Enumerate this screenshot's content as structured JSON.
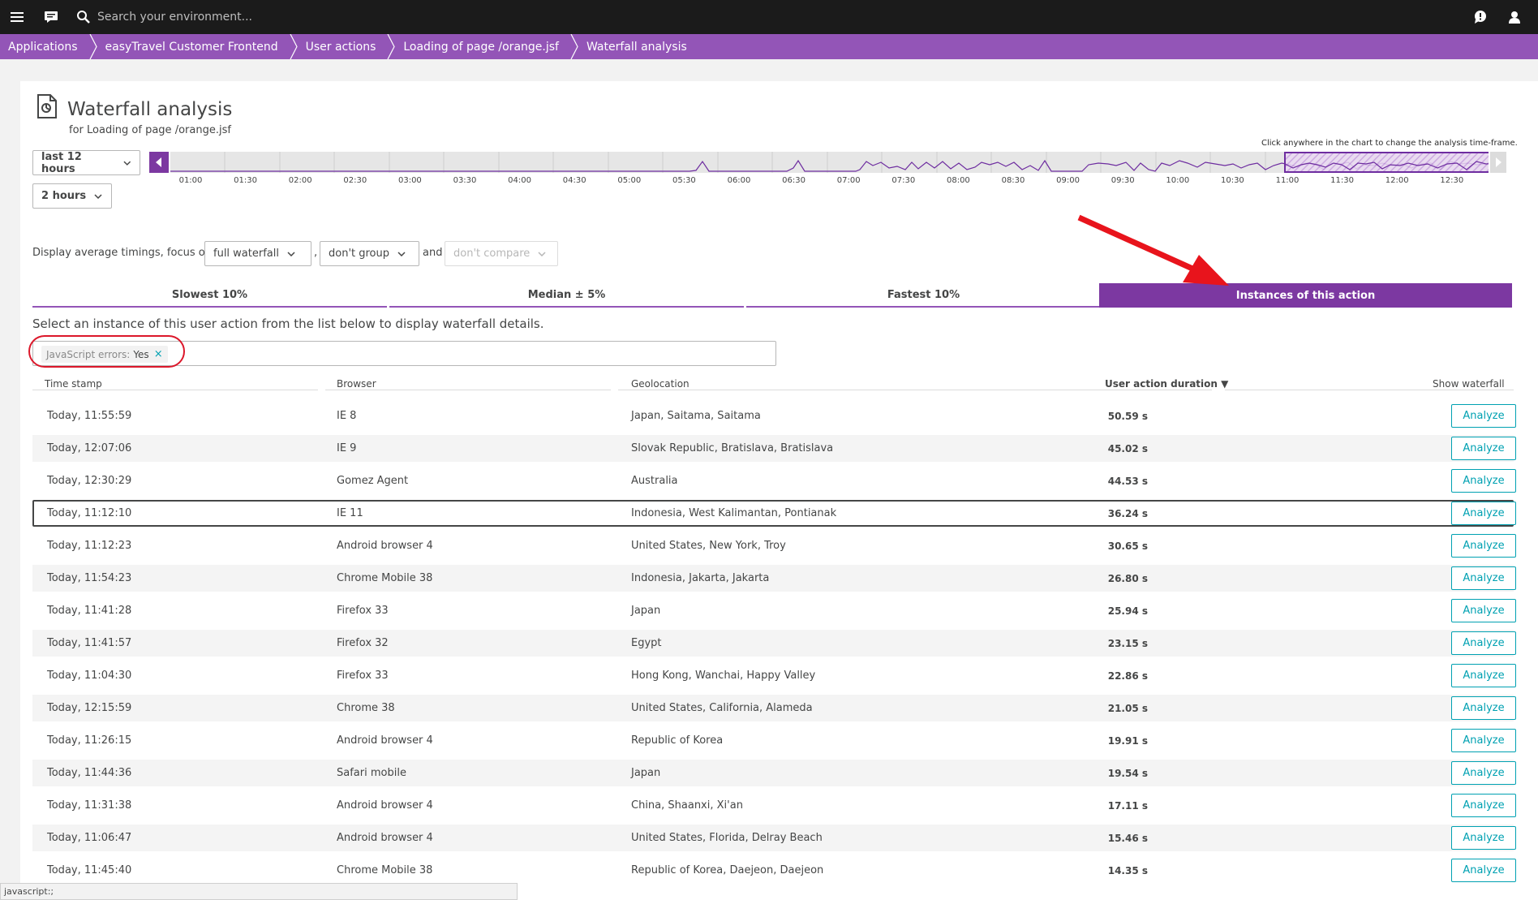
{
  "topbar": {
    "search_placeholder": "Search your environment...",
    "icons": [
      "menu-icon",
      "chat-icon",
      "search-icon",
      "help-bubble-icon",
      "user-icon"
    ]
  },
  "breadcrumb": [
    "Applications",
    "easyTravel Customer Frontend",
    "User actions",
    "Loading of page /orange.jsf",
    "Waterfall analysis"
  ],
  "page": {
    "title": "Waterfall analysis",
    "subtitle": "for Loading of page /orange.jsf"
  },
  "timeframe": {
    "range": "last 12 hours",
    "resolution": "2 hours",
    "hint": "Click anywhere in the chart to change the analysis time-frame.",
    "labels": [
      "01:00",
      "01:30",
      "02:00",
      "02:30",
      "03:00",
      "03:30",
      "04:00",
      "04:30",
      "05:00",
      "05:30",
      "06:00",
      "06:30",
      "07:00",
      "07:30",
      "08:00",
      "08:30",
      "09:00",
      "09:30",
      "10:00",
      "10:30",
      "11:00",
      "11:30",
      "12:00",
      "12:30"
    ]
  },
  "display": {
    "prefix": "Display average timings, focus on",
    "focus": "full waterfall",
    "comma": ",",
    "group": "don't group",
    "and": "and",
    "compare": "don't compare"
  },
  "tabs": [
    {
      "label": "Slowest 10%",
      "active": false
    },
    {
      "label": "Median ± 5%",
      "active": false
    },
    {
      "label": "Fastest 10%",
      "active": false
    },
    {
      "label": "Instances of this action",
      "active": true
    }
  ],
  "instruction": "Select an instance of this user action from the list below to display waterfall details.",
  "filter": {
    "key": "JavaScript errors:",
    "value": "Yes",
    "remove": "×"
  },
  "table": {
    "headers": {
      "timestamp": "Time stamp",
      "browser": "Browser",
      "geolocation": "Geolocation",
      "duration": "User action duration ▼",
      "waterfall": "Show waterfall"
    },
    "button_label": "Analyze",
    "rows": [
      {
        "timestamp": "Today, 11:55:59",
        "browser": "IE 8",
        "geolocation": "Japan, Saitama, Saitama",
        "duration": "50.59 s"
      },
      {
        "timestamp": "Today, 12:07:06",
        "browser": "IE 9",
        "geolocation": "Slovak Republic, Bratislava, Bratislava",
        "duration": "45.02 s"
      },
      {
        "timestamp": "Today, 12:30:29",
        "browser": "Gomez Agent",
        "geolocation": "Australia",
        "duration": "44.53 s"
      },
      {
        "timestamp": "Today, 11:12:10",
        "browser": "IE 11",
        "geolocation": "Indonesia, West Kalimantan, Pontianak",
        "duration": "36.24 s"
      },
      {
        "timestamp": "Today, 11:12:23",
        "browser": "Android browser 4",
        "geolocation": "United States, New York, Troy",
        "duration": "30.65 s"
      },
      {
        "timestamp": "Today, 11:54:23",
        "browser": "Chrome Mobile 38",
        "geolocation": "Indonesia, Jakarta, Jakarta",
        "duration": "26.80 s"
      },
      {
        "timestamp": "Today, 11:41:28",
        "browser": "Firefox 33",
        "geolocation": "Japan",
        "duration": "25.94 s"
      },
      {
        "timestamp": "Today, 11:41:57",
        "browser": "Firefox 32",
        "geolocation": "Egypt",
        "duration": "23.15 s"
      },
      {
        "timestamp": "Today, 11:04:30",
        "browser": "Firefox 33",
        "geolocation": "Hong Kong, Wanchai, Happy Valley",
        "duration": "22.86 s"
      },
      {
        "timestamp": "Today, 12:15:59",
        "browser": "Chrome 38",
        "geolocation": "United States, California, Alameda",
        "duration": "21.05 s"
      },
      {
        "timestamp": "Today, 11:26:15",
        "browser": "Android browser 4",
        "geolocation": "Republic of Korea",
        "duration": "19.91 s"
      },
      {
        "timestamp": "Today, 11:44:36",
        "browser": "Safari mobile",
        "geolocation": "Japan",
        "duration": "19.54 s"
      },
      {
        "timestamp": "Today, 11:31:38",
        "browser": "Android browser 4",
        "geolocation": "China, Shaanxi, Xi'an",
        "duration": "17.11 s"
      },
      {
        "timestamp": "Today, 11:06:47",
        "browser": "Android browser 4",
        "geolocation": "United States, Florida, Delray Beach",
        "duration": "15.46 s"
      },
      {
        "timestamp": "Today, 11:45:40",
        "browser": "Chrome Mobile 38",
        "geolocation": "Republic of Korea, Daejeon, Daejeon",
        "duration": "14.35 s"
      }
    ]
  },
  "status_bar": "javascript:;",
  "colors": {
    "accent": "#9355b7",
    "accent_dark": "#7c38a1",
    "link": "#00a1b2",
    "annotation": "#dc172a"
  }
}
